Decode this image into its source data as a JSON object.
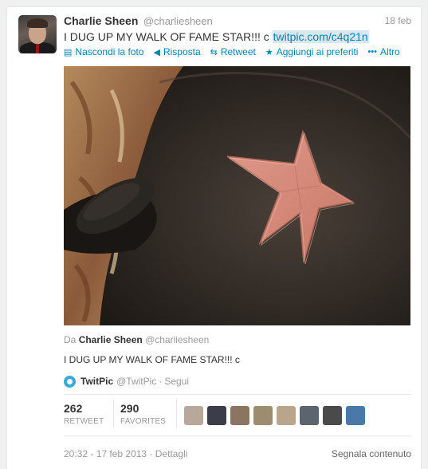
{
  "tweet": {
    "author_name": "Charlie Sheen",
    "author_handle": "@charliesheen",
    "date": "18 feb",
    "text": "I DUG UP MY WALK OF FAME STAR!!! c ",
    "link": "twitpic.com/c4q21n"
  },
  "actions": [
    {
      "label": "Nascondi la foto",
      "icon": "photo-icon"
    },
    {
      "label": "Risposta",
      "icon": "reply-icon"
    },
    {
      "label": "Retweet",
      "icon": "retweet-icon"
    },
    {
      "label": "Aggiungi ai preferiti",
      "icon": "star-icon"
    },
    {
      "label": "Altro",
      "icon": "more-icon"
    }
  ],
  "media": {
    "attribution_prefix": "Da",
    "attribution_name": "Charlie Sheen",
    "attribution_handle": "@charliesheen",
    "caption": "I DUG UP MY WALK OF FAME STAR!!! c",
    "source_name": "TwitPic",
    "source_handle": "@TwitPic",
    "source_sep": "·",
    "follow_label": "Segui"
  },
  "stats": {
    "retweets_count": "262",
    "retweets_label": "RETWEET",
    "favorites_count": "290",
    "favorites_label": "FAVORITES"
  },
  "favoriters": [
    {
      "color": "#b8a89a"
    },
    {
      "color": "#3d3d4a"
    },
    {
      "color": "#8a7560"
    },
    {
      "color": "#9c8d70"
    },
    {
      "color": "#b9a48c"
    },
    {
      "color": "#5c6470"
    },
    {
      "color": "#4a4a4a"
    },
    {
      "color": "#4a78a8"
    }
  ],
  "footer": {
    "timestamp": "20:32 - 17 feb 2013",
    "details_sep": "·",
    "details_label": "Dettagli",
    "report_label": "Segnala contenuto"
  },
  "colors": {
    "link": "#0084b4",
    "link_highlight": "#d9e6ef",
    "star": "#d4887a"
  }
}
